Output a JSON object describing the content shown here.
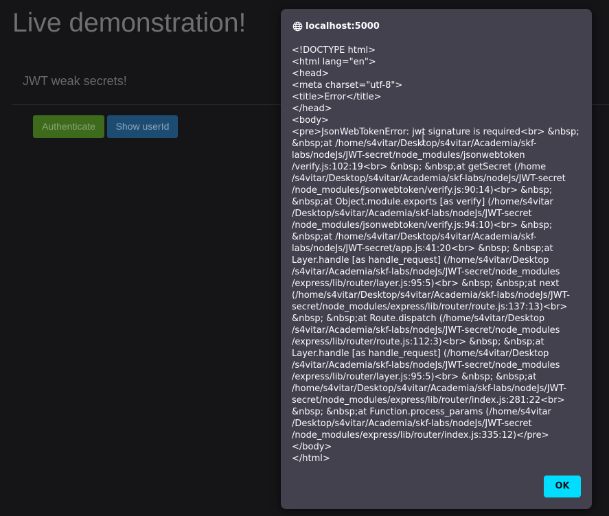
{
  "background_page": {
    "title": "Live demonstration!",
    "panel_title": "JWT weak secrets!",
    "authenticate_label": "Authenticate",
    "show_userid_label": "Show userId",
    "colors": {
      "authenticate_bg": "#3e6a1c",
      "show_userid_bg": "#1d4c72"
    }
  },
  "dialog": {
    "origin": "localhost:5000",
    "origin_icon": "globe-icon",
    "message": "<!DOCTYPE html>\n<html lang=\"en\">\n<head>\n<meta charset=\"utf-8\">\n<title>Error</title>\n</head>\n<body>\n<pre>JsonWebTokenError: jwt signature is required<br> &nbsp; &nbsp;at /home/s4vitar/Desktop/s4vitar/Academia/skf-labs/nodeJs/JWT-secret/node_modules/jsonwebtoken /verify.js:102:19<br> &nbsp; &nbsp;at getSecret (/home /s4vitar/Desktop/s4vitar/Academia/skf-labs/nodeJs/JWT-secret /node_modules/jsonwebtoken/verify.js:90:14)<br> &nbsp; &nbsp;at Object.module.exports [as verify] (/home/s4vitar /Desktop/s4vitar/Academia/skf-labs/nodeJs/JWT-secret /node_modules/jsonwebtoken/verify.js:94:10)<br> &nbsp; &nbsp;at /home/s4vitar/Desktop/s4vitar/Academia/skf-labs/nodeJs/JWT-secret/app.js:41:20<br> &nbsp; &nbsp;at Layer.handle [as handle_request] (/home/s4vitar/Desktop /s4vitar/Academia/skf-labs/nodeJs/JWT-secret/node_modules /express/lib/router/layer.js:95:5)<br> &nbsp; &nbsp;at next (/home/s4vitar/Desktop/s4vitar/Academia/skf-labs/nodeJs/JWT-secret/node_modules/express/lib/router/route.js:137:13)<br> &nbsp; &nbsp;at Route.dispatch (/home/s4vitar/Desktop /s4vitar/Academia/skf-labs/nodeJs/JWT-secret/node_modules /express/lib/router/route.js:112:3)<br> &nbsp; &nbsp;at Layer.handle [as handle_request] (/home/s4vitar/Desktop /s4vitar/Academia/skf-labs/nodeJs/JWT-secret/node_modules /express/lib/router/layer.js:95:5)<br> &nbsp; &nbsp;at /home/s4vitar/Desktop/s4vitar/Academia/skf-labs/nodeJs/JWT-secret/node_modules/express/lib/router/index.js:281:22<br> &nbsp; &nbsp;at Function.process_params (/home/s4vitar /Desktop/s4vitar/Academia/skf-labs/nodeJs/JWT-secret /node_modules/express/lib/router/index.js:335:12)</pre>\n</body>\n</html>",
    "ok_label": "OK",
    "colors": {
      "background": "#42414d",
      "ok_button": "#00ddff"
    }
  }
}
